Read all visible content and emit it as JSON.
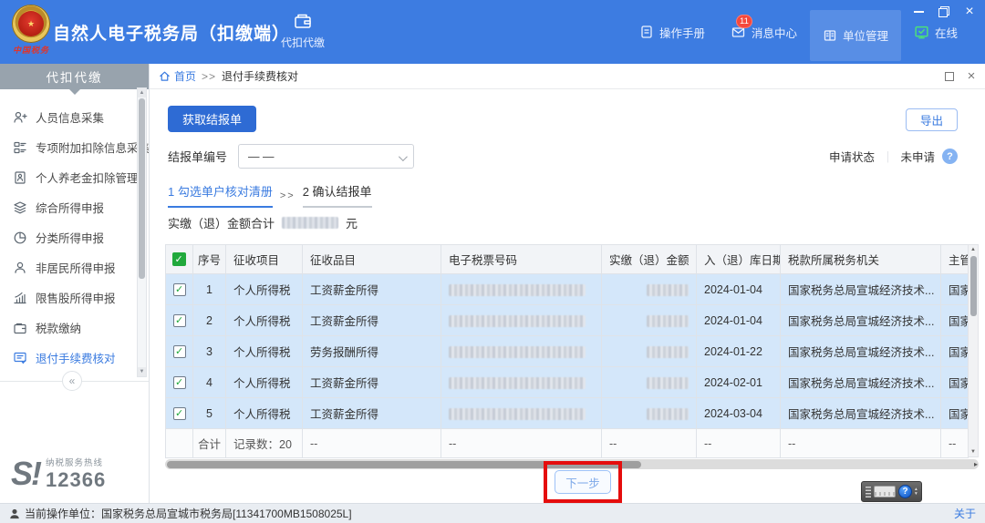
{
  "topbar": {
    "title": "自然人电子税务局（扣缴端）",
    "logo_caption": "中国税务",
    "tab_label": "代扣代缴",
    "nav": {
      "manual": "操作手册",
      "messages": "消息中心",
      "messages_badge": "11",
      "org": "单位管理",
      "online": "在线"
    }
  },
  "sidebar": {
    "header": "代扣代缴",
    "items": [
      "人员信息采集",
      "专项附加扣除信息采集",
      "个人养老金扣除管理",
      "综合所得申报",
      "分类所得申报",
      "非居民所得申报",
      "限售股所得申报",
      "税款缴纳",
      "退付手续费核对"
    ],
    "collapse": "«",
    "hotline": {
      "logo": "S!",
      "label": "纳税服务热线",
      "number": "12366"
    }
  },
  "breadcrumb": {
    "home": "首页",
    "separator": ">>",
    "current": "退付手续费核对"
  },
  "toolbar": {
    "fetch_button": "获取结报单",
    "export_button": "导出",
    "report_no_label": "结报单编号",
    "report_no_value": "— —",
    "status_label": "申请状态",
    "status_divider": "｜",
    "status_value": "未申请",
    "help_icon": "?"
  },
  "steps": {
    "step1": "1 勾选单户核对清册",
    "separator": ">>",
    "step2": "2 确认结报单"
  },
  "summary": {
    "label": "实缴（退）金额合计",
    "unit": "元"
  },
  "table": {
    "headers": {
      "seq": "序号",
      "item": "征收项目",
      "category": "征收品目",
      "ticket": "电子税票号码",
      "amount": "实缴（退）金额",
      "date": "入（退）库日期",
      "authority": "税款所属税务机关",
      "supervisor": "主管"
    },
    "rows": [
      {
        "seq": "1",
        "item": "个人所得税",
        "category": "工资薪金所得",
        "date": "2024-01-04",
        "authority": "国家税务总局宣城经济技术...",
        "supervisor": "国家"
      },
      {
        "seq": "2",
        "item": "个人所得税",
        "category": "工资薪金所得",
        "date": "2024-01-04",
        "authority": "国家税务总局宣城经济技术...",
        "supervisor": "国家"
      },
      {
        "seq": "3",
        "item": "个人所得税",
        "category": "劳务报酬所得",
        "date": "2024-01-22",
        "authority": "国家税务总局宣城经济技术...",
        "supervisor": "国家"
      },
      {
        "seq": "4",
        "item": "个人所得税",
        "category": "工资薪金所得",
        "date": "2024-02-01",
        "authority": "国家税务总局宣城经济技术...",
        "supervisor": "国家"
      },
      {
        "seq": "5",
        "item": "个人所得税",
        "category": "工资薪金所得",
        "date": "2024-03-04",
        "authority": "国家税务总局宣城经济技术...",
        "supervisor": "国家"
      }
    ],
    "footer": {
      "label": "合计",
      "count": "记录数：20",
      "dash": "--"
    }
  },
  "next_button": "下一步",
  "ime": {
    "help_icon": "?"
  },
  "statusbar": {
    "operator": "当前操作单位：国家税务总局宣城市税务局[11341700MB1508025L]",
    "about": "关于"
  },
  "colors": {
    "header_blue": "#3d7ce1",
    "accent_blue": "#3a7be0",
    "row_highlight": "#d4e7fa",
    "badge_red": "#f5483d",
    "annotation_red": "#e50d0d",
    "check_green": "#21a93c"
  }
}
